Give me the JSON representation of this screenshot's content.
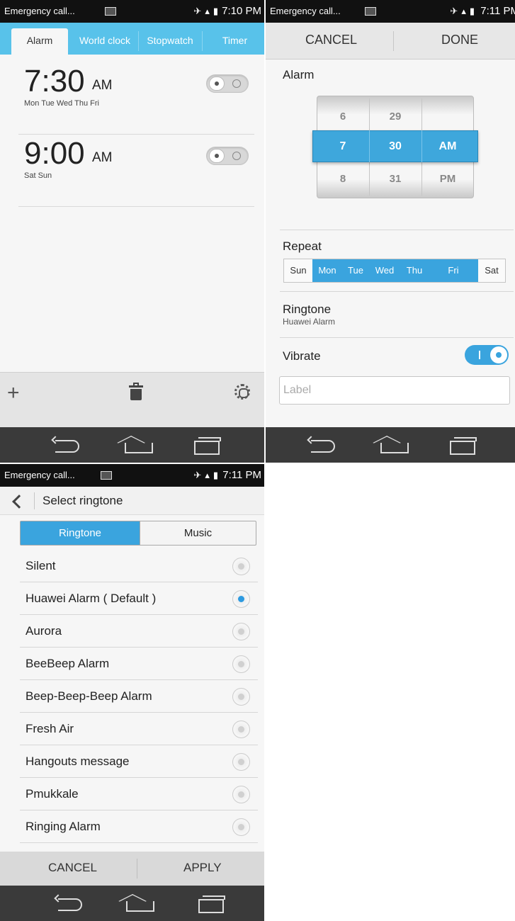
{
  "status_bar": {
    "carrier": "Emergency call...",
    "screen1_time": "7:10 PM",
    "screen2_time": "7:11 PM",
    "screen3_time": "7:11 PM"
  },
  "alarm_list_screen": {
    "tabs": [
      "Alarm",
      "World clock",
      "Stopwatch",
      "Timer"
    ],
    "active_tab": "Alarm",
    "alarms": [
      {
        "time": "7:30",
        "ampm": "AM",
        "days": "Mon Tue Wed Thu Fri",
        "enabled": false
      },
      {
        "time": "9:00",
        "ampm": "AM",
        "days": "Sat Sun",
        "enabled": false
      }
    ],
    "bottom_actions": [
      "add-icon",
      "trash-icon",
      "gear-icon"
    ]
  },
  "edit_alarm_screen": {
    "cancel_label": "CANCEL",
    "done_label": "DONE",
    "alarm_section_label": "Alarm",
    "picker": {
      "hours": [
        "6",
        "7",
        "8"
      ],
      "minutes": [
        "29",
        "30",
        "31"
      ],
      "periods": [
        "",
        "AM",
        "PM"
      ],
      "selected": {
        "hour": "7",
        "minute": "30",
        "period": "AM"
      }
    },
    "repeat_label": "Repeat",
    "days": [
      "Sun",
      "Mon",
      "Tue",
      "Wed",
      "Thu",
      "Fri",
      "Sat"
    ],
    "days_selected": [
      false,
      true,
      true,
      true,
      true,
      true,
      false
    ],
    "ringtone_label": "Ringtone",
    "ringtone_value": "Huawei Alarm",
    "vibrate_label": "Vibrate",
    "vibrate_on": true,
    "label_placeholder": "Label",
    "accent_color": "#3aa4de"
  },
  "ringtone_screen": {
    "title": "Select ringtone",
    "segments": [
      "Ringtone",
      "Music"
    ],
    "active_segment": "Ringtone",
    "items": [
      {
        "name": "Silent",
        "selected": false
      },
      {
        "name": "Huawei Alarm ( Default )",
        "selected": true
      },
      {
        "name": "Aurora",
        "selected": false
      },
      {
        "name": "BeeBeep Alarm",
        "selected": false
      },
      {
        "name": "Beep-Beep-Beep Alarm",
        "selected": false
      },
      {
        "name": "Fresh Air",
        "selected": false
      },
      {
        "name": "Hangouts message",
        "selected": false
      },
      {
        "name": "Pmukkale",
        "selected": false
      },
      {
        "name": "Ringing Alarm",
        "selected": false
      }
    ],
    "cancel_label": "CANCEL",
    "apply_label": "APPLY"
  },
  "nav_bar": [
    "back-icon",
    "home-icon",
    "recent-apps-icon"
  ]
}
